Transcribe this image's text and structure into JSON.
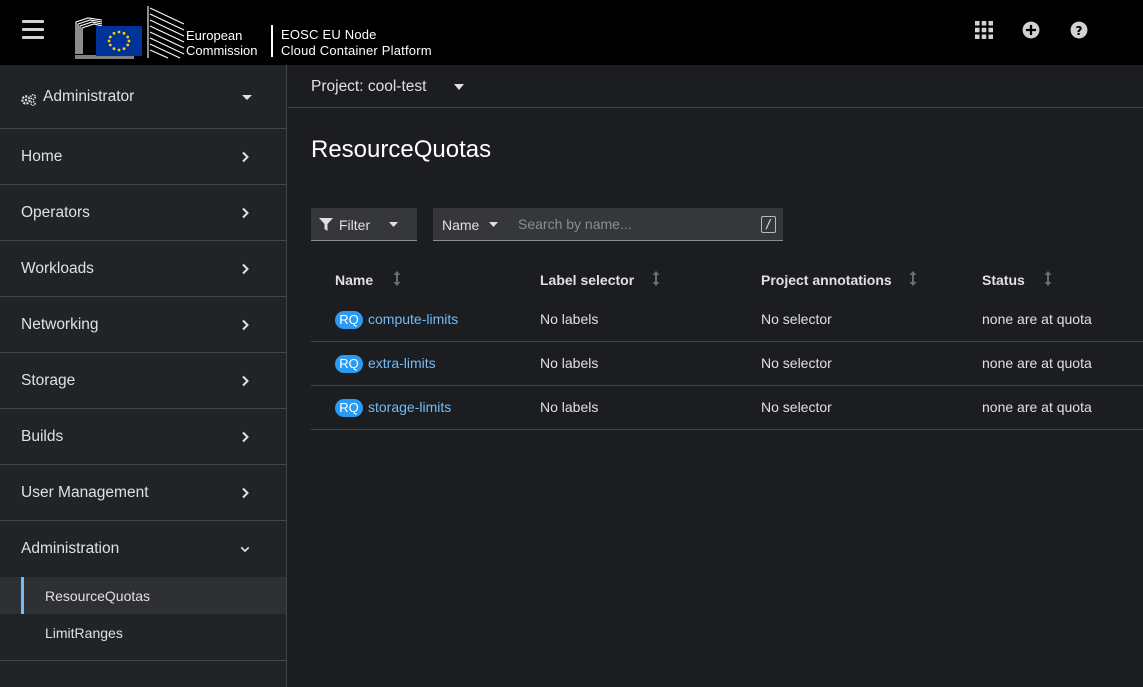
{
  "masthead": {
    "logo_text_line1": "European",
    "logo_text_line2": "Commission",
    "brand_line1": "EOSC EU Node",
    "brand_line2": "Cloud Container Platform",
    "icons": [
      "hamburger-icon",
      "app-launcher-icon",
      "plus-circle-icon",
      "help-icon"
    ]
  },
  "sidebar": {
    "perspective": "Administrator",
    "items": [
      {
        "label": "Home"
      },
      {
        "label": "Operators"
      },
      {
        "label": "Workloads"
      },
      {
        "label": "Networking"
      },
      {
        "label": "Storage"
      },
      {
        "label": "Builds"
      },
      {
        "label": "User Management"
      },
      {
        "label": "Administration"
      }
    ],
    "subitems": [
      {
        "label": "ResourceQuotas",
        "active": true
      },
      {
        "label": "LimitRanges",
        "active": false
      }
    ]
  },
  "project": {
    "label": "Project: cool-test"
  },
  "page": {
    "title": "ResourceQuotas"
  },
  "toolbar": {
    "filter_label": "Filter",
    "name_select": "Name",
    "search_placeholder": "Search by name...",
    "shortcut_hint": "/"
  },
  "table": {
    "headers": [
      "Name",
      "Label selector",
      "Project annotations",
      "Status"
    ],
    "rows": [
      {
        "badge": "RQ",
        "name": "compute-limits",
        "label_selector": "No labels",
        "annotations": "No selector",
        "status": "none are at quota"
      },
      {
        "badge": "RQ",
        "name": "extra-limits",
        "label_selector": "No labels",
        "annotations": "No selector",
        "status": "none are at quota"
      },
      {
        "badge": "RQ",
        "name": "storage-limits",
        "label_selector": "No labels",
        "annotations": "No selector",
        "status": "none are at quota"
      }
    ]
  },
  "colors": {
    "link": "#73bcf7",
    "badge": "#2b9af3",
    "masthead_bg": "#000000",
    "sidebar_bg": "#212427",
    "main_bg": "#1b1d21",
    "eu_blue": "#003399",
    "eu_star": "#ffcc00"
  }
}
